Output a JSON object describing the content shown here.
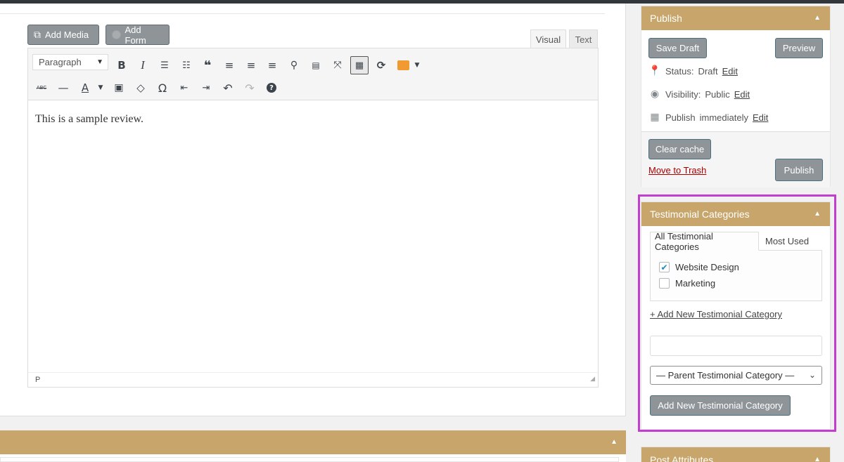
{
  "editor": {
    "add_media_label": "Add Media",
    "add_form_label": "Add Form",
    "tab_visual": "Visual",
    "tab_text": "Text",
    "format_select": "Paragraph",
    "content": "This is a sample review.",
    "status_path": "P",
    "toolbar_row1": [
      {
        "name": "bold-icon",
        "glyph": "B"
      },
      {
        "name": "italic-icon",
        "glyph": "I"
      },
      {
        "name": "bulleted-list-icon",
        "glyph": "☰"
      },
      {
        "name": "numbered-list-icon",
        "glyph": "≡"
      },
      {
        "name": "blockquote-icon",
        "glyph": "❝"
      },
      {
        "name": "align-left-icon",
        "glyph": "≡"
      },
      {
        "name": "align-center-icon",
        "glyph": "≡"
      },
      {
        "name": "align-right-icon",
        "glyph": "≡"
      },
      {
        "name": "link-icon",
        "glyph": "🔗"
      },
      {
        "name": "read-more-icon",
        "glyph": "▬"
      },
      {
        "name": "fullscreen-icon",
        "glyph": "⤧"
      },
      {
        "name": "toolbar-toggle-icon",
        "glyph": "⌨"
      },
      {
        "name": "refresh-icon",
        "glyph": "⟳"
      }
    ],
    "toolbar_row2": [
      {
        "name": "strikethrough-icon",
        "glyph": "ABC"
      },
      {
        "name": "horizontal-line-icon",
        "glyph": "—"
      },
      {
        "name": "text-color-icon",
        "glyph": "A"
      },
      {
        "name": "paste-text-icon",
        "glyph": "📋"
      },
      {
        "name": "clear-formatting-icon",
        "glyph": "◇"
      },
      {
        "name": "special-character-icon",
        "glyph": "Ω"
      },
      {
        "name": "outdent-icon",
        "glyph": "⇤"
      },
      {
        "name": "indent-icon",
        "glyph": "⇥"
      },
      {
        "name": "undo-icon",
        "glyph": "↶"
      },
      {
        "name": "redo-icon",
        "glyph": "↷"
      },
      {
        "name": "help-icon",
        "glyph": "?"
      }
    ]
  },
  "publish": {
    "title": "Publish",
    "save_draft": "Save Draft",
    "preview": "Preview",
    "status_label": "Status:",
    "status_value": "Draft",
    "visibility_label": "Visibility:",
    "visibility_value": "Public",
    "publish_label": "Publish",
    "publish_value": "immediately",
    "edit": "Edit",
    "clear_cache": "Clear cache",
    "move_to_trash": "Move to Trash",
    "publish_button": "Publish"
  },
  "testimonial_categories": {
    "title": "Testimonial Categories",
    "tab_all": "All Testimonial Categories",
    "tab_most_used": "Most Used",
    "items": [
      {
        "label": "Website Design",
        "checked": true
      },
      {
        "label": "Marketing",
        "checked": false
      }
    ],
    "add_new_link": "+ Add New Testimonial Category",
    "parent_select": "— Parent Testimonial Category —",
    "add_button": "Add New Testimonial Category"
  },
  "post_attributes": {
    "title": "Post Attributes"
  },
  "colors": {
    "accent": "#c8a66b",
    "button": "#8f9498",
    "highlight": "#c33ecf",
    "trash": "#aa0000"
  }
}
